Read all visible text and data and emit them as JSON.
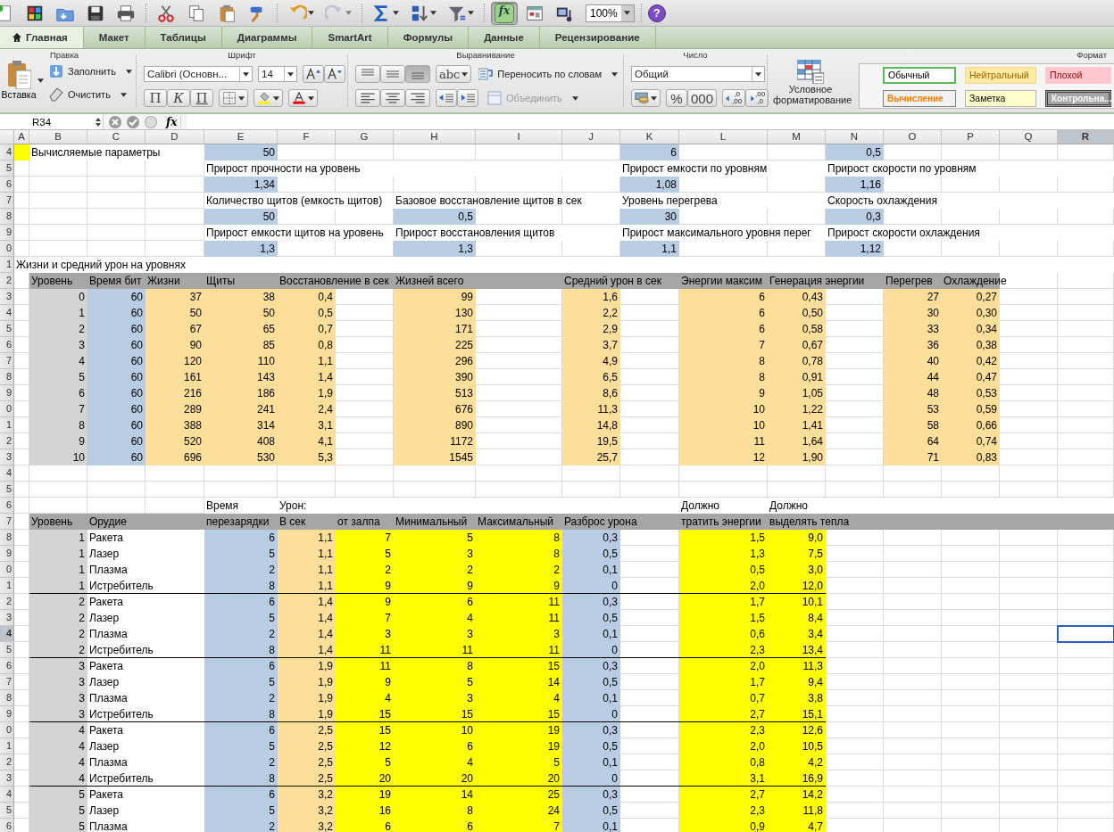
{
  "toolbar": {
    "buttons": [
      {
        "disabled": false,
        "pressed": false
      },
      {
        "disabled": false,
        "pressed": false
      },
      {
        "disabled": false,
        "pressed": false
      },
      {
        "disabled": false,
        "pressed": false
      },
      {
        "disabled": false,
        "pressed": false
      },
      {
        "disabled": false,
        "pressed": false
      },
      {
        "disabled": false,
        "pressed": false
      },
      {
        "disabled": false,
        "pressed": false
      },
      {
        "disabled": false,
        "pressed": false
      },
      {
        "disabled": false,
        "pressed": false
      },
      {
        "disabled": true,
        "pressed": false
      },
      {
        "disabled": false,
        "pressed": false
      },
      {
        "disabled": false,
        "pressed": false
      },
      {
        "disabled": false,
        "pressed": false
      },
      {
        "disabled": false,
        "pressed": true,
        "text": "fx"
      },
      {
        "disabled": false,
        "pressed": false
      },
      {
        "disabled": false,
        "pressed": false
      }
    ],
    "zoom": "100%",
    "help": "?"
  },
  "tabs": [
    {
      "label": "Главная",
      "selected": true
    },
    {
      "label": "Макет",
      "selected": false
    },
    {
      "label": "Таблицы",
      "selected": false
    },
    {
      "label": "Диаграммы",
      "selected": false
    },
    {
      "label": "SmartArt",
      "selected": false
    },
    {
      "label": "Формулы",
      "selected": false
    },
    {
      "label": "Данные",
      "selected": false
    },
    {
      "label": "Рецензирование",
      "selected": false
    }
  ],
  "ribbon": {
    "edit": {
      "title": "Правка",
      "paste": "Вставка",
      "fill": "Заполнить",
      "clear": "Очистить"
    },
    "font": {
      "title": "Шрифт",
      "name": "Calibri (Основн...",
      "size": "14",
      "bold": "П",
      "italic": "К",
      "underline": "П"
    },
    "alignment": {
      "title": "Выравнивание",
      "top_row": [
        {
          "selected": false
        },
        {
          "selected": false
        },
        {
          "selected": true
        }
      ],
      "bottom_row": [
        {
          "selected": false
        },
        {
          "selected": false
        },
        {
          "selected": false
        }
      ],
      "orientation": "abc",
      "wrap": "Переносить по словам",
      "merge": {
        "label": "Объединить",
        "disabled": true
      }
    },
    "number": {
      "title": "Число",
      "format": "Общий",
      "percent": "%",
      "thousands": "000",
      "decimals": [
        {
          "top": ",0",
          "bottom": ",00"
        },
        {
          "top": ",00",
          "bottom": ",0"
        }
      ]
    },
    "conditional": {
      "label": "Условное форматирование"
    },
    "styles": {
      "title": "Формат",
      "items": [
        {
          "label": "Обычный",
          "color": "#ffffff"
        },
        {
          "label": "Нейтральный",
          "color": "#fde9a0"
        },
        {
          "label": "Плохой",
          "color": "#ffc7ce"
        },
        {
          "label": "Вычисление",
          "color": "#f2f2f2"
        },
        {
          "label": "Заметка",
          "color": "#ffffcc"
        },
        {
          "label": "Контрольна...",
          "color": "#a5a5a5"
        }
      ]
    }
  },
  "formula_bar": {
    "name_box": "R34",
    "fx": "fx"
  },
  "columns": [
    {
      "letter": "A",
      "selected": false
    },
    {
      "letter": "B",
      "selected": false
    },
    {
      "letter": "C",
      "selected": false
    },
    {
      "letter": "D",
      "selected": false
    },
    {
      "letter": "E",
      "selected": false
    },
    {
      "letter": "F",
      "selected": false
    },
    {
      "letter": "G",
      "selected": false
    },
    {
      "letter": "H",
      "selected": false
    },
    {
      "letter": "I",
      "selected": false
    },
    {
      "letter": "J",
      "selected": false
    },
    {
      "letter": "K",
      "selected": false
    },
    {
      "letter": "L",
      "selected": false
    },
    {
      "letter": "M",
      "selected": false
    },
    {
      "letter": "N",
      "selected": false
    },
    {
      "letter": "O",
      "selected": false
    },
    {
      "letter": "P",
      "selected": false
    },
    {
      "letter": "Q",
      "selected": false
    },
    {
      "letter": "R",
      "selected": true
    }
  ],
  "row_headers": [
    {
      "num": "4",
      "selected": false
    },
    {
      "num": "5",
      "selected": false
    },
    {
      "num": "6",
      "selected": false
    },
    {
      "num": "7",
      "selected": false
    },
    {
      "num": "8",
      "selected": false
    },
    {
      "num": "9",
      "selected": false
    },
    {
      "num": "0",
      "selected": false
    },
    {
      "num": "1",
      "selected": false
    },
    {
      "num": "2",
      "selected": false
    },
    {
      "num": "3",
      "selected": false
    },
    {
      "num": "4",
      "selected": false
    },
    {
      "num": "5",
      "selected": false
    },
    {
      "num": "6",
      "selected": false
    },
    {
      "num": "7",
      "selected": false
    },
    {
      "num": "8",
      "selected": false
    },
    {
      "num": "9",
      "selected": false
    },
    {
      "num": "0",
      "selected": false
    },
    {
      "num": "1",
      "selected": false
    },
    {
      "num": "2",
      "selected": false
    },
    {
      "num": "3",
      "selected": false
    },
    {
      "num": "4",
      "selected": false
    },
    {
      "num": "5",
      "selected": false
    },
    {
      "num": "6",
      "selected": false
    },
    {
      "num": "7",
      "selected": false
    },
    {
      "num": "8",
      "selected": false
    },
    {
      "num": "9",
      "selected": false
    },
    {
      "num": "0",
      "selected": false
    },
    {
      "num": "1",
      "selected": false
    },
    {
      "num": "2",
      "selected": false
    },
    {
      "num": "3",
      "selected": false
    },
    {
      "num": "4",
      "selected": true
    },
    {
      "num": "5",
      "selected": false
    },
    {
      "num": "6",
      "selected": false
    },
    {
      "num": "7",
      "selected": false
    },
    {
      "num": "8",
      "selected": false
    },
    {
      "num": "9",
      "selected": false
    },
    {
      "num": "0",
      "selected": false
    },
    {
      "num": "1",
      "selected": false
    },
    {
      "num": "2",
      "selected": false
    },
    {
      "num": "3",
      "selected": false
    },
    {
      "num": "4",
      "selected": false
    },
    {
      "num": "5",
      "selected": false
    },
    {
      "num": "6",
      "selected": false
    }
  ],
  "parameters": {
    "title": "Вычисляемые параметры",
    "columns": [
      [
        {
          "value": "50"
        },
        {
          "label": "Прирост прочности на уровень",
          "value": "1,34"
        },
        {
          "label": "Количество щитов (емкость щитов)",
          "value": "50"
        },
        {
          "label": "Прирост емкости щитов на уровень",
          "value": "1,3"
        }
      ],
      [
        {
          "label": "Базовое восстановление щитов в сек",
          "value": "0,5"
        },
        {
          "label": "Прирост восстановления щитов",
          "value": "1,3"
        }
      ],
      [
        {
          "value": "6"
        },
        {
          "label": "Прирост емкости по уровням",
          "value": "1,08"
        },
        {
          "label": "Уровень перегрева",
          "value": "30"
        },
        {
          "label": "Прирост максимального уровня перег",
          "value": "1,1"
        }
      ],
      [
        {
          "value": "0,5"
        },
        {
          "label": "Прирост скорости по уровням",
          "value": "1,16"
        },
        {
          "label": "Скорость охлаждения",
          "value": "0,3"
        },
        {
          "label": "Прирост скорости охлаждения",
          "value": "1,12"
        }
      ]
    ]
  },
  "levels": {
    "title": "Жизни и средний урон на уровнях",
    "header": [
      "Уровень",
      "Время бит",
      "Жизни",
      "Щиты",
      "Восстановление в сек",
      "Жизней всего",
      "Средний урон в сек",
      "Энергии максим",
      "Генерация энергии",
      "Перегрев",
      "Охлаждение"
    ],
    "rows": [
      [
        "0",
        "60",
        "37",
        "38",
        "0,4",
        "99",
        "1,6",
        "6",
        "0,43",
        "27",
        "0,27"
      ],
      [
        "1",
        "60",
        "50",
        "50",
        "0,5",
        "130",
        "2,2",
        "6",
        "0,50",
        "30",
        "0,30"
      ],
      [
        "2",
        "60",
        "67",
        "65",
        "0,7",
        "171",
        "2,9",
        "6",
        "0,58",
        "33",
        "0,34"
      ],
      [
        "3",
        "60",
        "90",
        "85",
        "0,8",
        "225",
        "3,7",
        "7",
        "0,67",
        "36",
        "0,38"
      ],
      [
        "4",
        "60",
        "120",
        "110",
        "1,1",
        "296",
        "4,9",
        "8",
        "0,78",
        "40",
        "0,42"
      ],
      [
        "5",
        "60",
        "161",
        "143",
        "1,4",
        "390",
        "6,5",
        "8",
        "0,91",
        "44",
        "0,47"
      ],
      [
        "6",
        "60",
        "216",
        "186",
        "1,9",
        "513",
        "8,6",
        "9",
        "1,05",
        "48",
        "0,53"
      ],
      [
        "7",
        "60",
        "289",
        "241",
        "2,4",
        "676",
        "11,3",
        "10",
        "1,22",
        "53",
        "0,59"
      ],
      [
        "8",
        "60",
        "388",
        "314",
        "3,1",
        "890",
        "14,8",
        "10",
        "1,41",
        "58",
        "0,66"
      ],
      [
        "9",
        "60",
        "520",
        "408",
        "4,1",
        "1172",
        "19,5",
        "11",
        "1,64",
        "64",
        "0,74"
      ],
      [
        "10",
        "60",
        "696",
        "530",
        "5,3",
        "1545",
        "25,7",
        "12",
        "1,90",
        "71",
        "0,83"
      ]
    ]
  },
  "weapons": {
    "header_top": [
      "Время",
      "Урон:",
      "Должно",
      "Должно"
    ],
    "header": [
      "Уровень",
      "Орудие",
      "перезарядки",
      "В сек",
      "от залпа",
      "Минимальный",
      "Максимальный",
      "Разброс урона",
      "тратить энергии",
      "выделять тепла"
    ],
    "rows": [
      {
        "divider": false,
        "values": [
          "1",
          "Ракета",
          "6",
          "1,1",
          "7",
          "5",
          "8",
          "0,3",
          "1,5",
          "9,0"
        ]
      },
      {
        "divider": false,
        "values": [
          "1",
          "Лазер",
          "5",
          "1,1",
          "5",
          "3",
          "8",
          "0,5",
          "1,3",
          "7,5"
        ]
      },
      {
        "divider": false,
        "values": [
          "1",
          "Плазма",
          "2",
          "1,1",
          "2",
          "2",
          "2",
          "0,1",
          "0,5",
          "3,0"
        ]
      },
      {
        "divider": true,
        "values": [
          "1",
          "Истребитель",
          "8",
          "1,1",
          "9",
          "9",
          "9",
          "0",
          "2,0",
          "12,0"
        ]
      },
      {
        "divider": false,
        "values": [
          "2",
          "Ракета",
          "6",
          "1,4",
          "9",
          "6",
          "11",
          "0,3",
          "1,7",
          "10,1"
        ]
      },
      {
        "divider": false,
        "values": [
          "2",
          "Лазер",
          "5",
          "1,4",
          "7",
          "4",
          "11",
          "0,5",
          "1,5",
          "8,4"
        ]
      },
      {
        "divider": false,
        "values": [
          "2",
          "Плазма",
          "2",
          "1,4",
          "3",
          "3",
          "3",
          "0,1",
          "0,6",
          "3,4"
        ]
      },
      {
        "divider": true,
        "values": [
          "2",
          "Истребитель",
          "8",
          "1,4",
          "11",
          "11",
          "11",
          "0",
          "2,3",
          "13,4"
        ]
      },
      {
        "divider": false,
        "values": [
          "3",
          "Ракета",
          "6",
          "1,9",
          "11",
          "8",
          "15",
          "0,3",
          "2,0",
          "11,3"
        ]
      },
      {
        "divider": false,
        "values": [
          "3",
          "Лазер",
          "5",
          "1,9",
          "9",
          "5",
          "14",
          "0,5",
          "1,7",
          "9,4"
        ]
      },
      {
        "divider": false,
        "values": [
          "3",
          "Плазма",
          "2",
          "1,9",
          "4",
          "3",
          "4",
          "0,1",
          "0,7",
          "3,8"
        ]
      },
      {
        "divider": true,
        "values": [
          "3",
          "Истребитель",
          "8",
          "1,9",
          "15",
          "15",
          "15",
          "0",
          "2,7",
          "15,1"
        ]
      },
      {
        "divider": false,
        "values": [
          "4",
          "Ракета",
          "6",
          "2,5",
          "15",
          "10",
          "19",
          "0,3",
          "2,3",
          "12,6"
        ]
      },
      {
        "divider": false,
        "values": [
          "4",
          "Лазер",
          "5",
          "2,5",
          "12",
          "6",
          "19",
          "0,5",
          "2,0",
          "10,5"
        ]
      },
      {
        "divider": false,
        "values": [
          "4",
          "Плазма",
          "2",
          "2,5",
          "5",
          "4",
          "5",
          "0,1",
          "0,8",
          "4,2"
        ]
      },
      {
        "divider": true,
        "values": [
          "4",
          "Истребитель",
          "8",
          "2,5",
          "20",
          "20",
          "20",
          "0",
          "3,1",
          "16,9"
        ]
      },
      {
        "divider": false,
        "values": [
          "5",
          "Ракета",
          "6",
          "3,2",
          "19",
          "14",
          "25",
          "0,3",
          "2,7",
          "14,2"
        ]
      },
      {
        "divider": false,
        "values": [
          "5",
          "Лазер",
          "5",
          "3,2",
          "16",
          "8",
          "24",
          "0,5",
          "2,3",
          "11,8"
        ]
      },
      {
        "divider": false,
        "values": [
          "5",
          "Плазма",
          "2",
          "3,2",
          "6",
          "6",
          "7",
          "0,1",
          "0,9",
          "4,7"
        ]
      }
    ]
  }
}
